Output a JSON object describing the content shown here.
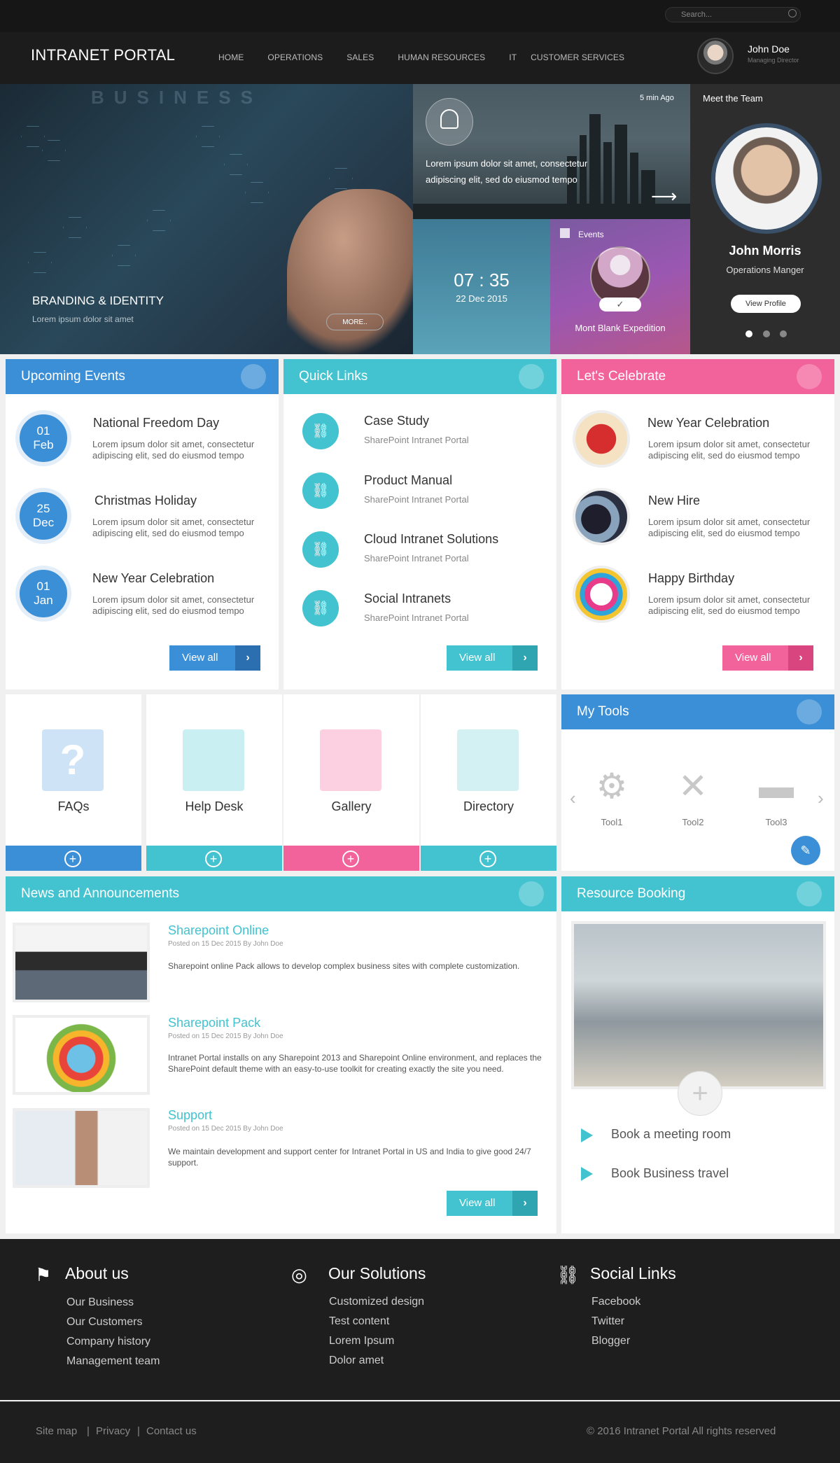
{
  "search": {
    "placeholder": "Search..."
  },
  "header": {
    "brand": "INTRANET PORTAL",
    "nav": [
      "HOME",
      "OPERATIONS",
      "SALES",
      "HUMAN RESOURCES",
      "IT",
      "CUSTOMER SERVICES"
    ],
    "user": "John Doe",
    "role": "Managing Director"
  },
  "hero": {
    "title": "BRANDING & IDENTITY",
    "sub": "Lorem ipsum dolor sit amet",
    "more": "MORE..",
    "watermark": "BUSINESS"
  },
  "news_tile": {
    "time": "5 min Ago",
    "text": "Lorem ipsum dolor sit amet, consectetur adipiscing elit, sed do eiusmod tempo"
  },
  "clock": {
    "time": "07 : 35",
    "date": "22 Dec 2015"
  },
  "event_tile": {
    "label": "Events",
    "name": "Mont Blank Expedition"
  },
  "team": {
    "label": "Meet the Team",
    "name": "John Morris",
    "role": "Operations Manger",
    "button": "View Profile"
  },
  "upcoming": {
    "title": "Upcoming Events",
    "items": [
      {
        "day": "01",
        "mon": "Feb",
        "title": "National Freedom Day",
        "text": "Lorem ipsum dolor sit amet, consectetur adipiscing elit, sed do eiusmod tempo"
      },
      {
        "day": "25",
        "mon": "Dec",
        "title": "Christmas Holiday",
        "text": "Lorem ipsum dolor sit amet, consectetur adipiscing elit, sed do eiusmod tempo"
      },
      {
        "day": "01",
        "mon": "Jan",
        "title": "New Year Celebration",
        "text": "Lorem ipsum dolor sit amet, consectetur adipiscing elit, sed do eiusmod tempo"
      }
    ],
    "view_all": "View all"
  },
  "quick": {
    "title": "Quick Links",
    "items": [
      {
        "title": "Case Study",
        "sub": "SharePoint Intranet Portal"
      },
      {
        "title": "Product Manual",
        "sub": "SharePoint Intranet Portal"
      },
      {
        "title": "Cloud Intranet Solutions",
        "sub": "SharePoint Intranet Portal"
      },
      {
        "title": "Social Intranets",
        "sub": "SharePoint Intranet Portal"
      }
    ],
    "view_all": "View all"
  },
  "celebrate": {
    "title": "Let's Celebrate",
    "items": [
      {
        "title": "New Year Celebration",
        "text": "Lorem ipsum dolor sit amet, consectetur adipiscing elit, sed do eiusmod tempo"
      },
      {
        "title": "New Hire",
        "text": "Lorem ipsum dolor sit amet, consectetur adipiscing elit, sed do eiusmod tempo"
      },
      {
        "title": "Happy Birthday",
        "text": "Lorem ipsum dolor sit amet, consectetur adipiscing elit, sed do eiusmod tempo"
      }
    ],
    "view_all": "View all"
  },
  "tiles": [
    {
      "label": "FAQs"
    },
    {
      "label": "Help Desk"
    },
    {
      "label": "Gallery"
    },
    {
      "label": "Directory"
    }
  ],
  "tools": {
    "title": "My Tools",
    "items": [
      "Tool1",
      "Tool2",
      "Tool3"
    ]
  },
  "news": {
    "title": "News and Announcements",
    "items": [
      {
        "title": "Sharepoint Online",
        "meta": "Posted on 15 Dec 2015 By John Doe",
        "body": "Sharepoint online Pack allows to develop complex business sites with complete customization."
      },
      {
        "title": "Sharepoint Pack",
        "meta": "Posted on 15 Dec 2015 By John Doe",
        "body": "Intranet Portal installs on any Sharepoint 2013 and Sharepoint Online environment, and replaces the SharePoint default theme with an easy-to-use toolkit for creating exactly the site you need."
      },
      {
        "title": "Support",
        "meta": "Posted on 15 Dec 2015 By John Doe",
        "body": "We maintain development and support center for Intranet Portal in US and India to give good 24/7 support."
      }
    ],
    "view_all": "View all"
  },
  "booking": {
    "title": "Resource Booking",
    "items": [
      "Book a meeting room",
      "Book Business travel"
    ]
  },
  "footer": {
    "about": {
      "title": "About us",
      "links": [
        "Our Business",
        "Our Customers",
        "Company history",
        "Management team"
      ]
    },
    "solutions": {
      "title": "Our Solutions",
      "links": [
        "Customized design",
        "Test content",
        "Lorem Ipsum",
        "Dolor amet"
      ]
    },
    "social": {
      "title": "Social Links",
      "links": [
        "Facebook",
        "Twitter",
        "Blogger"
      ]
    },
    "bottom": {
      "sitemap": "Site map",
      "privacy": "Privacy",
      "contact": "Contact us",
      "sep": "|",
      "copy": "© 2016 Intranet Portal All rights reserved"
    }
  },
  "colors": {
    "blue": "#3b8fd6",
    "teal": "#43c3d0",
    "pink": "#f2629b"
  }
}
